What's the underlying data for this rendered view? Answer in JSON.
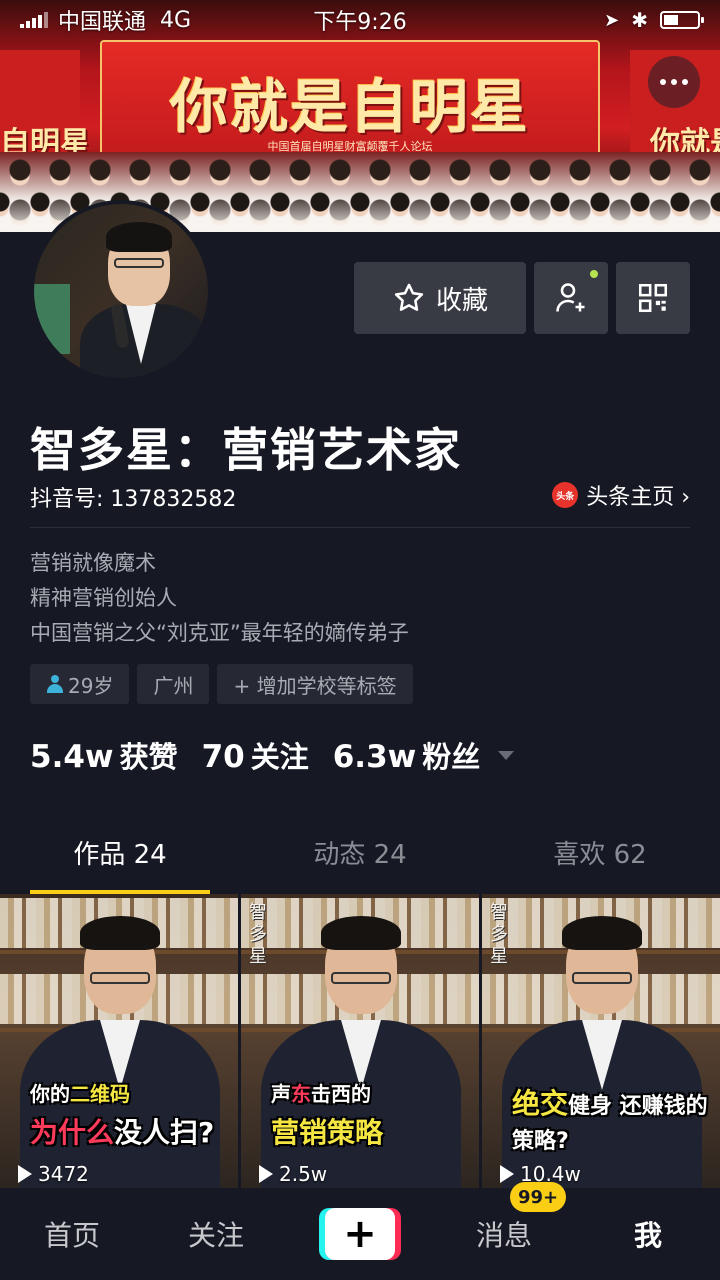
{
  "status_bar": {
    "carrier": "中国联通",
    "network": "4G",
    "time": "下午9:26"
  },
  "cover": {
    "slogan": "你就是自明星",
    "slogan_sub": "中国首届自明星财富颠覆千人论坛",
    "side_left": "自明星",
    "side_right": "你就是"
  },
  "profile": {
    "name": "智多星：营销艺术家",
    "douyin_id": "抖音号: 137832582",
    "toutiao_logo": "头条",
    "toutiao_link": "头条主页 ›",
    "bio": [
      "营销就像魔术",
      "精神营销创始人",
      "中国营销之父“刘克亚”最年轻的嫡传弟子"
    ],
    "tags": [
      "29岁",
      "广州",
      "+ 增加学校等标签"
    ],
    "stats": [
      {
        "num": "5.4w",
        "label": "获赞"
      },
      {
        "num": "70",
        "label": "关注"
      },
      {
        "num": "6.3w",
        "label": "粉丝"
      }
    ]
  },
  "actions": {
    "favorite_label": "收藏",
    "add_friend_icon": "add-user-icon",
    "qr_icon": "qr-code-icon",
    "new_dot_color": "#b7e34f"
  },
  "tabs": [
    "作品 24",
    "动态 24",
    "喜欢 62"
  ],
  "videos": [
    {
      "cap1_pre": "你的",
      "cap1_hl": "二维码",
      "cap2_hl": "为什么",
      "cap2_post": "没人扫?",
      "count": "3472"
    },
    {
      "cap1_pre": "声",
      "cap1_hl": "东",
      "cap1_post": "击西的",
      "cap2_hl": "",
      "cap2_post": "营销策略",
      "count": "2.5w"
    },
    {
      "cap1_pre": "",
      "cap1_hl": "",
      "cap1_post": "",
      "cap2_hl": "绝交",
      "cap2_post": "健身 还赚钱的策略?",
      "count": "10.4w"
    }
  ],
  "video_watermark": "智多星",
  "bottom_nav": {
    "home": "首页",
    "follow": "关注",
    "add": "+",
    "messages": "消息",
    "messages_badge": "99+",
    "me": "我"
  },
  "colors": {
    "background": "#161823",
    "tab_indicator": "#face15",
    "badge": "#face15",
    "button_bg": "#393b44"
  }
}
